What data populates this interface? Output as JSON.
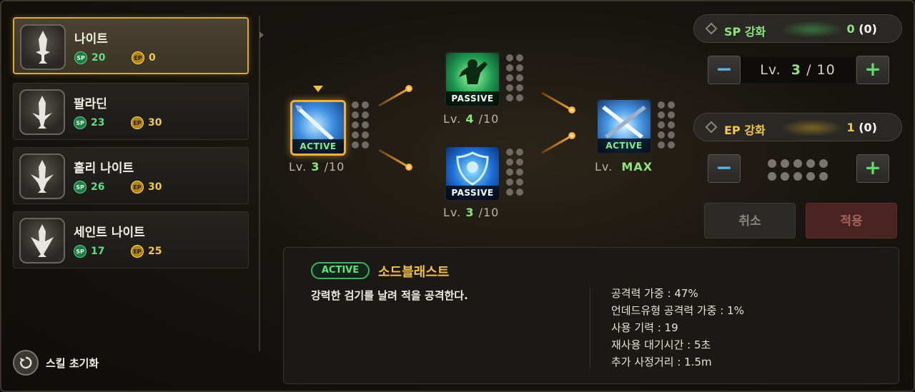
{
  "classes": [
    {
      "name": "나이트",
      "sp_label": "SP",
      "sp": "20",
      "ep_label": "EP",
      "ep": "0",
      "selected": true
    },
    {
      "name": "팔라딘",
      "sp_label": "SP",
      "sp": "23",
      "ep_label": "EP",
      "ep": "30",
      "selected": false
    },
    {
      "name": "홀리 나이트",
      "sp_label": "SP",
      "sp": "26",
      "ep_label": "EP",
      "ep": "30",
      "selected": false
    },
    {
      "name": "세인트 나이트",
      "sp_label": "SP",
      "sp": "17",
      "ep_label": "EP",
      "ep": "25",
      "selected": false
    }
  ],
  "reset_label": "스킬 초기화",
  "skills": {
    "root": {
      "tag": "ACTIVE",
      "lv_prefix": "Lv.",
      "level": "3",
      "sep": "/",
      "max": "10",
      "icon": "sword-slash-icon"
    },
    "passive_top": {
      "tag": "PASSIVE",
      "lv_prefix": "Lv.",
      "level": "4",
      "sep": "/",
      "max": "10",
      "icon": "flex-warrior-icon"
    },
    "passive_bottom": {
      "tag": "PASSIVE",
      "lv_prefix": "Lv.",
      "level": "3",
      "sep": "/",
      "max": "10",
      "icon": "holy-shield-icon"
    },
    "final": {
      "tag": "ACTIVE",
      "lv_prefix": "Lv.",
      "level_text": "MAX",
      "icon": "crossed-swords-icon"
    }
  },
  "sp_enhance": {
    "label": "SP 강화",
    "value": "0",
    "paren": "(0)"
  },
  "sp_level": {
    "prefix": "Lv.",
    "current": "3",
    "sep": "/",
    "max": "10"
  },
  "ep_enhance": {
    "label": "EP 강화",
    "value": "1",
    "paren": "(0)"
  },
  "buttons": {
    "minus": "−",
    "plus": "+",
    "cancel": "취소",
    "apply": "적용"
  },
  "detail": {
    "type": "ACTIVE",
    "name": "소드블래스트",
    "description": "강력한 검기를 날려 적을 공격한다.",
    "stats": [
      "공격력 가중 : 47%",
      "언데드유형 공격력 가중 : 1%",
      "사용 기력 : 19",
      "재사용 대기시간 : 5초",
      "추가 사정거리 : 1.5m"
    ]
  },
  "colors": {
    "accent_gold": "#f0b13a",
    "sp_green": "#8ee57c",
    "ep_yellow": "#f2c94c",
    "active_green": "#62e37e"
  }
}
